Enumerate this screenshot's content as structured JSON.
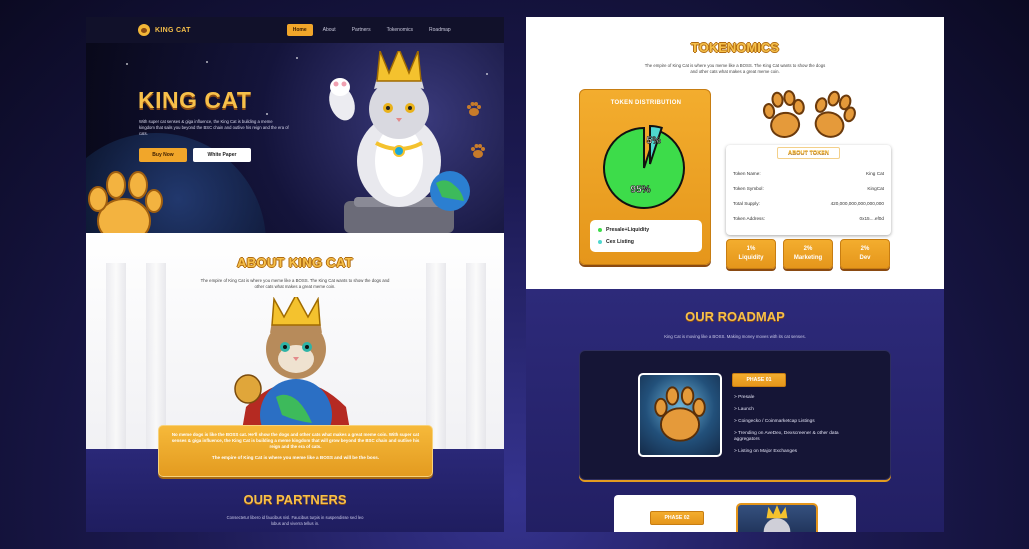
{
  "nav": {
    "logo_text": "KING CAT",
    "links": [
      {
        "label": "Home",
        "active": true
      },
      {
        "label": "About",
        "active": false
      },
      {
        "label": "Partners",
        "active": false
      },
      {
        "label": "Tokenomics",
        "active": false
      },
      {
        "label": "Roadmap",
        "active": false
      }
    ]
  },
  "hero": {
    "title": "KING CAT",
    "description": "With super cat senses & giga influence, the King Cat is building a meme kingdom that sails you beyond the BSC chain and outlive his reign and the era of cats.",
    "buy_label": "Buy Now",
    "whitepaper_label": "White Paper"
  },
  "about": {
    "title": "ABOUT KING CAT",
    "description": "The empire of King Cat is where you meme like a BOSS. The King Cat wants to show the dogs and other cats what makes a great meme coin.",
    "card_text": "No meme dogs is like the BOSS cat. He'll show the dogs and other cats what makes a great meme coin. With super cat senses & giga influence, the King Cat is building a meme kingdom that will grow beyond the BSC chain and outlive his reign and the era of cats.",
    "card_strong": "The empire of King Cat is where you meme like a BOSS and will be the boss."
  },
  "partners": {
    "title": "OUR PARTNERS",
    "description": "Consectetur libero id faucibus nisl. Faucibus turpis in suspendisse sed leo lobus and viverra tellus in."
  },
  "tokenomics": {
    "title": "TOKENOMICS",
    "description": "The empire of King Cat is where you meme like a BOSS. The King Cat wants to show the dogs and other cats what makes a great meme coin.",
    "distribution_title": "TOKEN DISTRIBUTION",
    "legend": [
      {
        "label": "Presale+Liquidity",
        "color": "#3ddc4a"
      },
      {
        "label": "Cex Listing",
        "color": "#4fd7cf"
      }
    ],
    "about_token_title": "ABOUT TOKEN",
    "rows": [
      {
        "label": "Token Name:",
        "value": "King Cat"
      },
      {
        "label": "Token Symbol:",
        "value": "KingCat"
      },
      {
        "label": "Total Supply:",
        "value": "420,000,000,000,000,000"
      },
      {
        "label": "Token Address:",
        "value": "0x15....ef0d"
      }
    ],
    "stats": [
      {
        "pct": "1%",
        "label": "Liquidity"
      },
      {
        "pct": "2%",
        "label": "Marketing"
      },
      {
        "pct": "2%",
        "label": "Dev"
      }
    ]
  },
  "chart_data": {
    "type": "pie",
    "title": "TOKEN DISTRIBUTION",
    "slices": [
      {
        "label": "Presale+Liquidity",
        "value": 95,
        "color": "#3ddc4a",
        "display": "95%"
      },
      {
        "label": "Cex Listing",
        "value": 5,
        "color": "#4fd7cf",
        "display": "5%"
      }
    ]
  },
  "roadmap": {
    "title": "OUR ROADMAP",
    "description": "King Cat is moving like a BOSS. Making money moves with its cat senses.",
    "phase1_label": "PHASE 01",
    "phase1_items": [
      "> Presale",
      "> Launch",
      "> Coingecko / Coinmarketcap Listings",
      "> Trending on AveDex, Dexscreener & other data aggregators",
      "> Listing on Major Exchanges"
    ],
    "phase2_label": "PHASE 02"
  }
}
